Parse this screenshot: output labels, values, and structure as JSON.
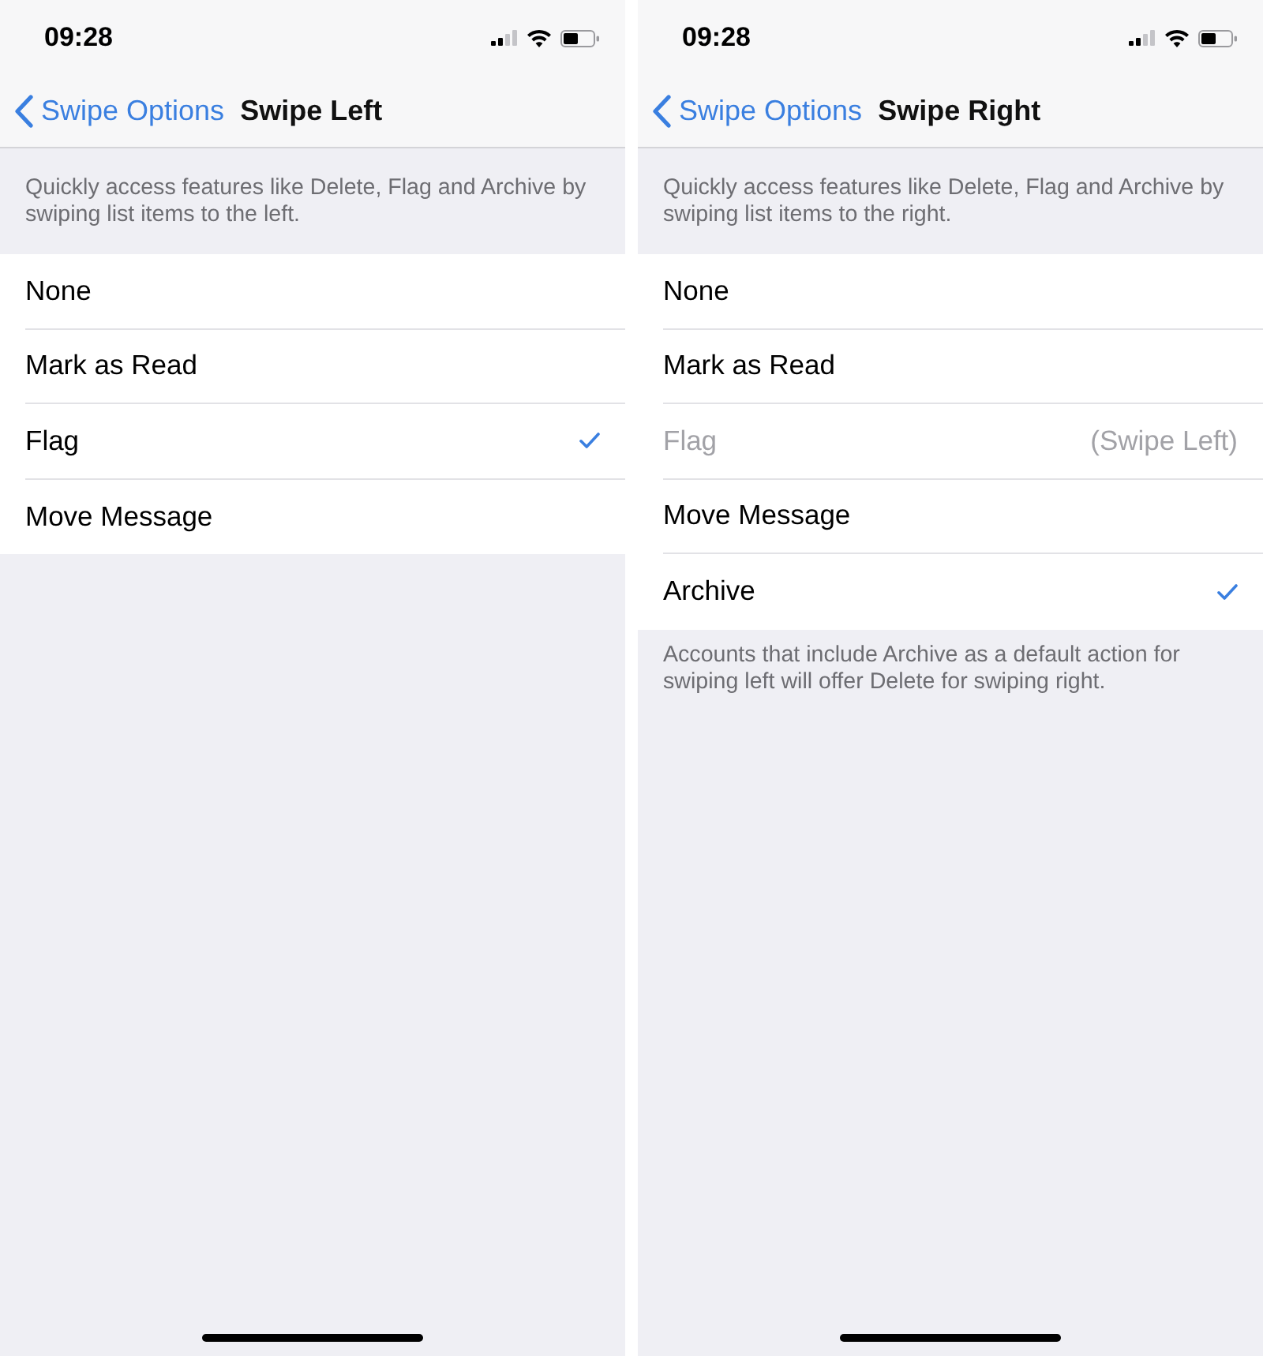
{
  "screens": [
    {
      "status_bar": {
        "time": "09:28"
      },
      "nav_bar": {
        "back": "Swipe Options",
        "title": "Swipe Left"
      },
      "description": "Quickly access features like Delete, Flag and Archive by swiping list items to the left.",
      "options": [
        {
          "label": "None",
          "selected": false,
          "disabled": false
        },
        {
          "label": "Mark as Read",
          "selected": false,
          "disabled": false
        },
        {
          "label": "Flag",
          "selected": true,
          "disabled": false
        },
        {
          "label": "Move Message",
          "selected": false,
          "disabled": false
        }
      ]
    },
    {
      "status_bar": {
        "time": "09:28"
      },
      "nav_bar": {
        "back": "Swipe Options",
        "title": "Swipe Right"
      },
      "description": "Quickly access features like Delete, Flag and Archive by swiping list items to the right.",
      "options": [
        {
          "label": "None",
          "selected": false,
          "disabled": false
        },
        {
          "label": "Mark as Read",
          "selected": false,
          "disabled": false
        },
        {
          "label": "Flag",
          "selected": false,
          "disabled": true,
          "detail": "(Swipe Left)"
        },
        {
          "label": "Move Message",
          "selected": false,
          "disabled": false
        },
        {
          "label": "Archive",
          "selected": true,
          "disabled": false
        }
      ],
      "footer": "Accounts that include Archive as a default action for swiping left will offer Delete for swiping right."
    }
  ]
}
